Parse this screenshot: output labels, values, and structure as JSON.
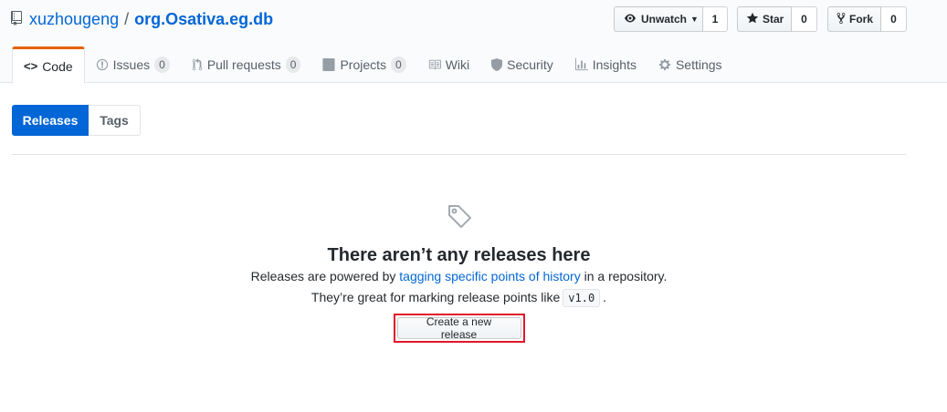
{
  "repo": {
    "owner": "xuzhougeng",
    "separator": "/",
    "name": "org.Osativa.eg.db"
  },
  "actions": {
    "watch": {
      "label": "Unwatch",
      "count": "1"
    },
    "star": {
      "label": "Star",
      "count": "0"
    },
    "fork": {
      "label": "Fork",
      "count": "0"
    }
  },
  "tabs": [
    {
      "label": "Code",
      "counter": ""
    },
    {
      "label": "Issues",
      "counter": "0"
    },
    {
      "label": "Pull requests",
      "counter": "0"
    },
    {
      "label": "Projects",
      "counter": "0"
    },
    {
      "label": "Wiki",
      "counter": ""
    },
    {
      "label": "Security",
      "counter": ""
    },
    {
      "label": "Insights",
      "counter": ""
    },
    {
      "label": "Settings",
      "counter": ""
    }
  ],
  "subnav": {
    "releases": "Releases",
    "tags": "Tags"
  },
  "blankslate": {
    "heading": "There aren’t any releases here",
    "line1_before": "Releases are powered by ",
    "line1_link": "tagging specific points of history",
    "line1_after": " in a repository.",
    "line2_before": "They’re great for marking release points like",
    "line2_code": "v1.0",
    "line2_after": ".",
    "button": "Create a new release"
  },
  "colors": {
    "accent": "#0366d6",
    "tab_highlight": "#e36209",
    "callout_border": "#e0162b"
  }
}
